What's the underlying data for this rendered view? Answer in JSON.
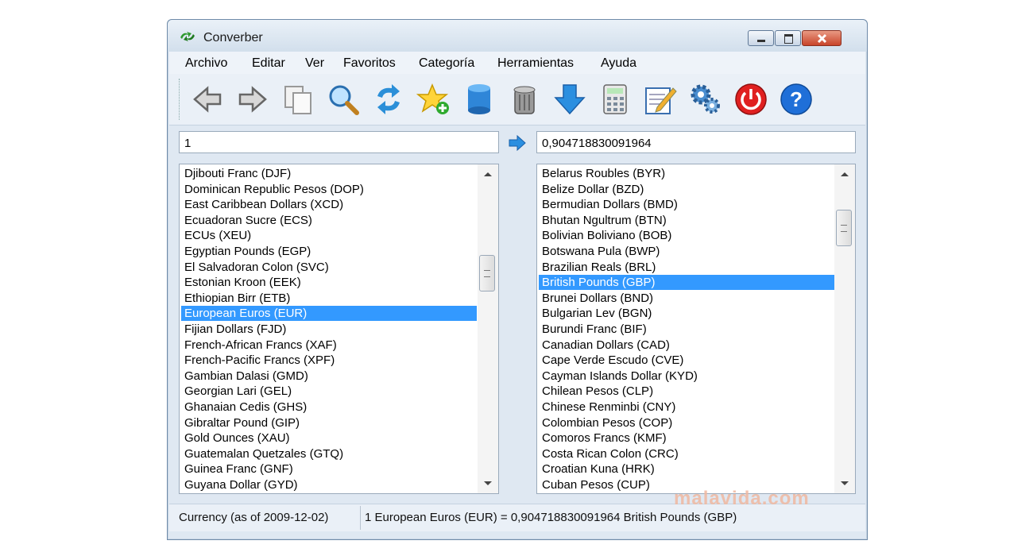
{
  "window": {
    "title": "Converber"
  },
  "menu": [
    "Archivo",
    "Editar",
    "Ver",
    "Favoritos",
    "Categoría",
    "Herramientas",
    "Ayuda"
  ],
  "toolbar": [
    "back-icon",
    "forward-icon",
    "copy-icon",
    "search-icon",
    "refresh-icon",
    "add-favorite-icon",
    "database-icon",
    "trash-icon",
    "download-icon",
    "calculator-icon",
    "edit-icon",
    "settings-icon",
    "power-icon",
    "help-icon"
  ],
  "input_value": "1",
  "output_value": "0,904718830091964",
  "left_list": {
    "items": [
      "Djibouti Franc (DJF)",
      "Dominican Republic Pesos (DOP)",
      "East Caribbean Dollars (XCD)",
      "Ecuadoran Sucre (ECS)",
      "ECUs (XEU)",
      "Egyptian Pounds (EGP)",
      "El Salvadoran Colon (SVC)",
      "Estonian Kroon (EEK)",
      "Ethiopian Birr (ETB)",
      "European Euros (EUR)",
      "Fijian Dollars (FJD)",
      "French-African Francs (XAF)",
      "French-Pacific Francs (XPF)",
      "Gambian Dalasi (GMD)",
      "Georgian Lari (GEL)",
      "Ghanaian Cedis (GHS)",
      "Gibraltar Pound (GIP)",
      "Gold Ounces (XAU)",
      "Guatemalan Quetzales (GTQ)",
      "Guinea Franc (GNF)",
      "Guyana Dollar (GYD)"
    ],
    "selected": 9
  },
  "right_list": {
    "items": [
      "Belarus Roubles (BYR)",
      "Belize Dollar (BZD)",
      "Bermudian Dollars (BMD)",
      "Bhutan Ngultrum (BTN)",
      "Bolivian Boliviano (BOB)",
      "Botswana Pula (BWP)",
      "Brazilian Reals (BRL)",
      "British Pounds (GBP)",
      "Brunei Dollars (BND)",
      "Bulgarian Lev (BGN)",
      "Burundi Franc (BIF)",
      "Canadian Dollars (CAD)",
      "Cape Verde Escudo (CVE)",
      "Cayman Islands Dollar (KYD)",
      "Chilean Pesos (CLP)",
      "Chinese Renminbi (CNY)",
      "Colombian Pesos (COP)",
      "Comoros Francs (KMF)",
      "Costa Rican Colon (CRC)",
      "Croatian Kuna (HRK)",
      "Cuban Pesos (CUP)"
    ],
    "selected": 7
  },
  "status": {
    "left": "Currency (as of 2009-12-02)",
    "right": "1 European Euros (EUR) = 0,904718830091964 British Pounds (GBP)"
  },
  "watermark": "malavida.com",
  "colors": {
    "selection": "#3399ff",
    "titlebar": "#d2dfec"
  }
}
